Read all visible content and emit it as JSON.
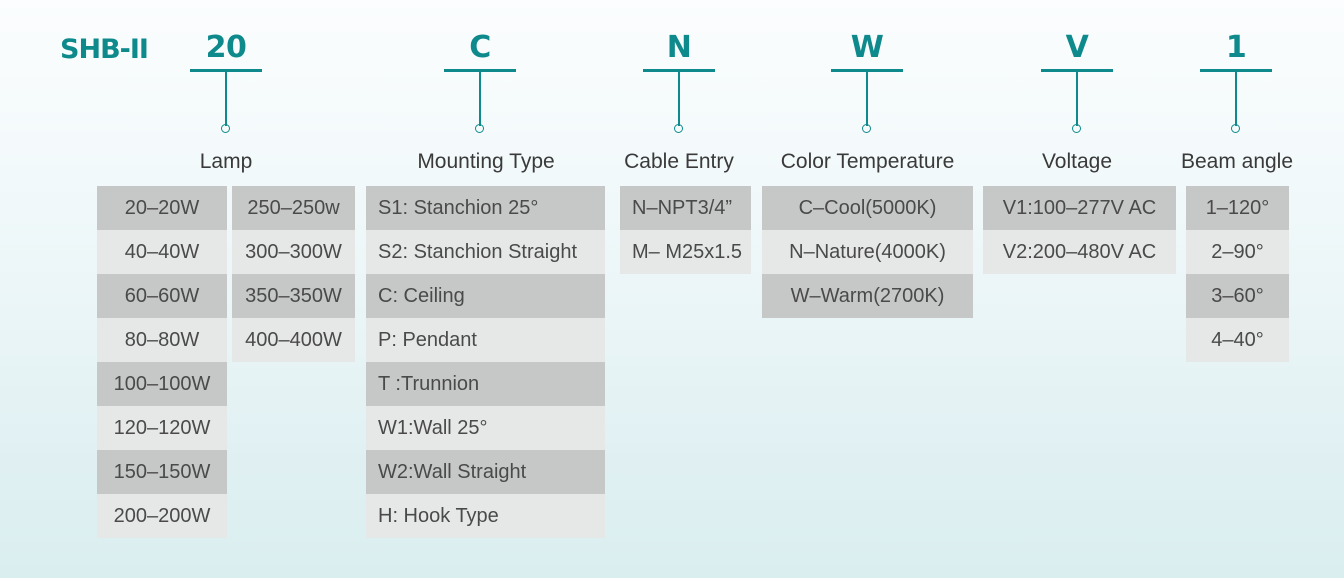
{
  "model": {
    "code": "SHB-II"
  },
  "columns": [
    {
      "id": "lamp",
      "code": "20",
      "caption": "Lamp",
      "groups": [
        {
          "id": "lamp-a",
          "options": [
            "20–20W",
            "40–40W",
            "60–60W",
            "80–80W",
            "100–100W",
            "120–120W",
            "150–150W",
            "200–200W"
          ]
        },
        {
          "id": "lamp-b",
          "options": [
            "250–250w",
            "300–300W",
            "350–350W",
            "400–400W"
          ]
        }
      ]
    },
    {
      "id": "mounting-type",
      "code": "C",
      "caption": "Mounting Type",
      "groups": [
        {
          "id": "mounting-a",
          "options": [
            "S1: Stanchion  25°",
            "S2: Stanchion Straight",
            "C: Ceiling",
            "P: Pendant",
            "T :Trunnion",
            "W1:Wall 25°",
            "W2:Wall Straight",
            "H: Hook Type"
          ]
        }
      ]
    },
    {
      "id": "cable-entry",
      "code": "N",
      "caption": "Cable Entry",
      "groups": [
        {
          "id": "cable-a",
          "options": [
            "N–NPT3/4”",
            "M– M25x1.5"
          ]
        }
      ]
    },
    {
      "id": "color-temperature",
      "code": "W",
      "caption": "Color Temperature",
      "groups": [
        {
          "id": "color-a",
          "options": [
            "C–Cool(5000K)",
            "N–Nature(4000K)",
            "W–Warm(2700K)"
          ]
        }
      ]
    },
    {
      "id": "voltage",
      "code": "V",
      "caption": "Voltage",
      "groups": [
        {
          "id": "voltage-a",
          "options": [
            "V1:100–277V AC",
            "V2:200–480V AC"
          ]
        }
      ]
    },
    {
      "id": "beam-angle",
      "code": "1",
      "caption": "Beam angle",
      "groups": [
        {
          "id": "beam-a",
          "options": [
            "1–120°",
            "2–90°",
            "3–60°",
            "4–40°"
          ]
        }
      ]
    }
  ],
  "colors": {
    "accent": "#0e8a8c",
    "cell_dark": "#c6c7c7",
    "cell_light": "#e6e7e7",
    "text": "#4a4a4a",
    "caption": "#3a3a3a",
    "background_top": "#fbfdfe",
    "background_bottom": "#daeef0"
  }
}
